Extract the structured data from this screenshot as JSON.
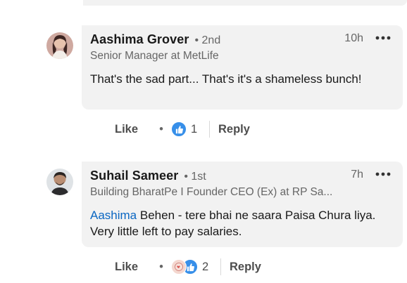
{
  "comments": [
    {
      "author": "Aashima Grover",
      "degree": "• 2nd",
      "headline": "Senior Manager at MetLife",
      "time": "10h",
      "text": "That's the sad part... That's it's a shameless bunch!",
      "mention": "",
      "actions": {
        "like": "Like",
        "dot": "•",
        "reactions": [
          "like"
        ],
        "reaction_count": "1",
        "reply": "Reply"
      }
    },
    {
      "author": "Suhail Sameer",
      "degree": "• 1st",
      "headline": "Building BharatPe I Founder CEO (Ex) at RP Sa...",
      "time": "7h",
      "text": " Behen - tere bhai ne saara Paisa Chura liya. Very little left to pay salaries.",
      "mention": "Aashima",
      "actions": {
        "like": "Like",
        "dot": "•",
        "reactions": [
          "love",
          "like"
        ],
        "reaction_count": "2",
        "reply": "Reply"
      }
    }
  ],
  "icons": {
    "more": "more-horizontal-icon",
    "like_reaction": "thumbs-up-icon",
    "love_reaction": "love-reaction-icon"
  },
  "colors": {
    "bubble": "#f2f2f2",
    "mention": "#0a66c2",
    "like_blue": "#378fe9"
  }
}
